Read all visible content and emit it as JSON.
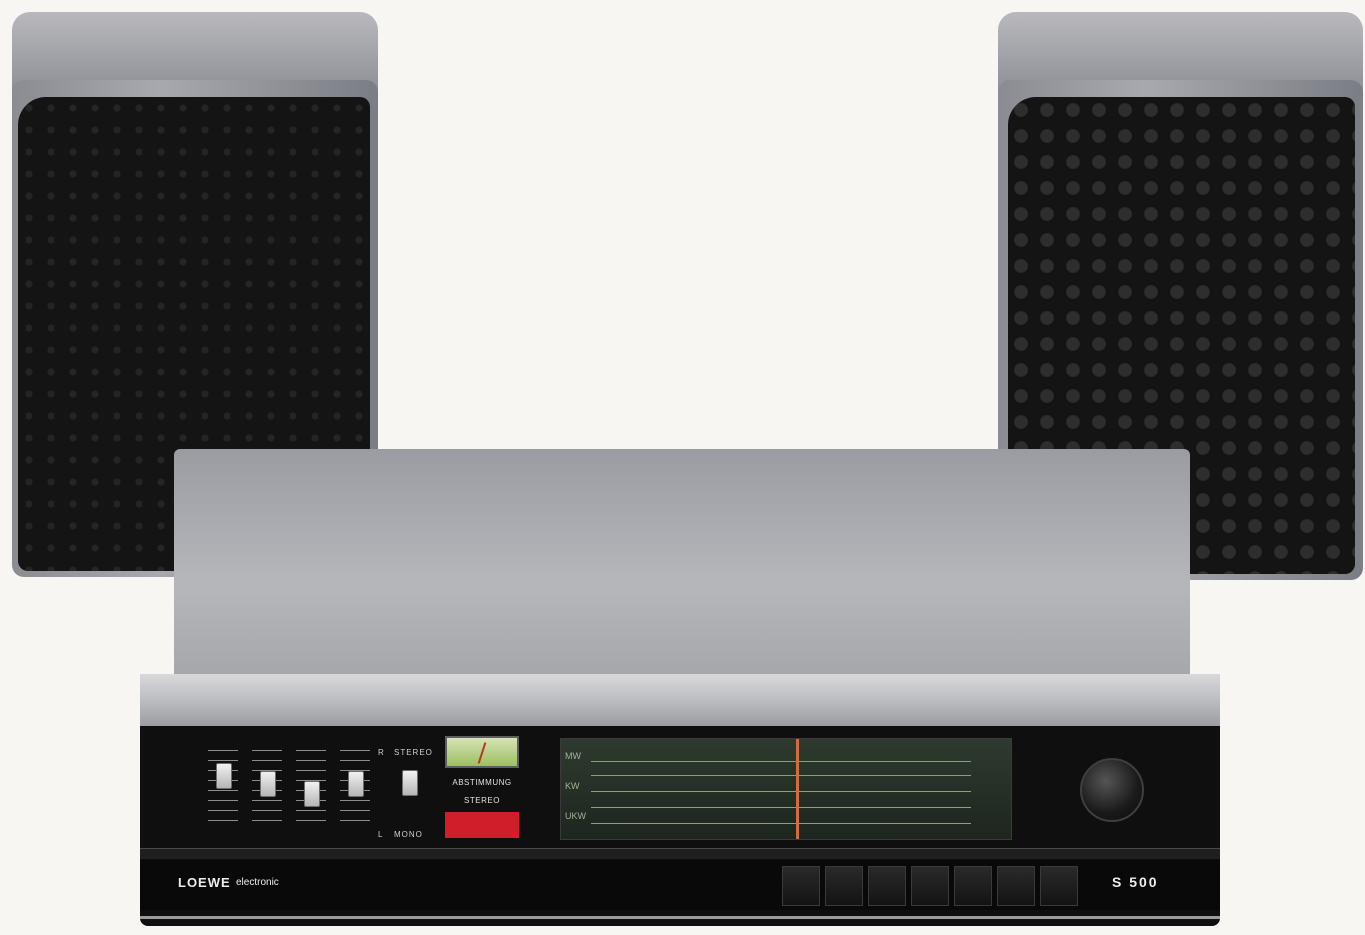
{
  "receiver": {
    "brand": "LOEWE",
    "brand_sub": "electronic",
    "model": "S 500",
    "stereo_label": "STEREO",
    "mono_label": "MONO",
    "r_label": "R",
    "l_label": "L",
    "abstimmung_label": "ABSTIMMUNG",
    "stereo_indicator_label": "STEREO",
    "dial_bands": [
      "MW",
      "KW",
      "UKW"
    ]
  }
}
